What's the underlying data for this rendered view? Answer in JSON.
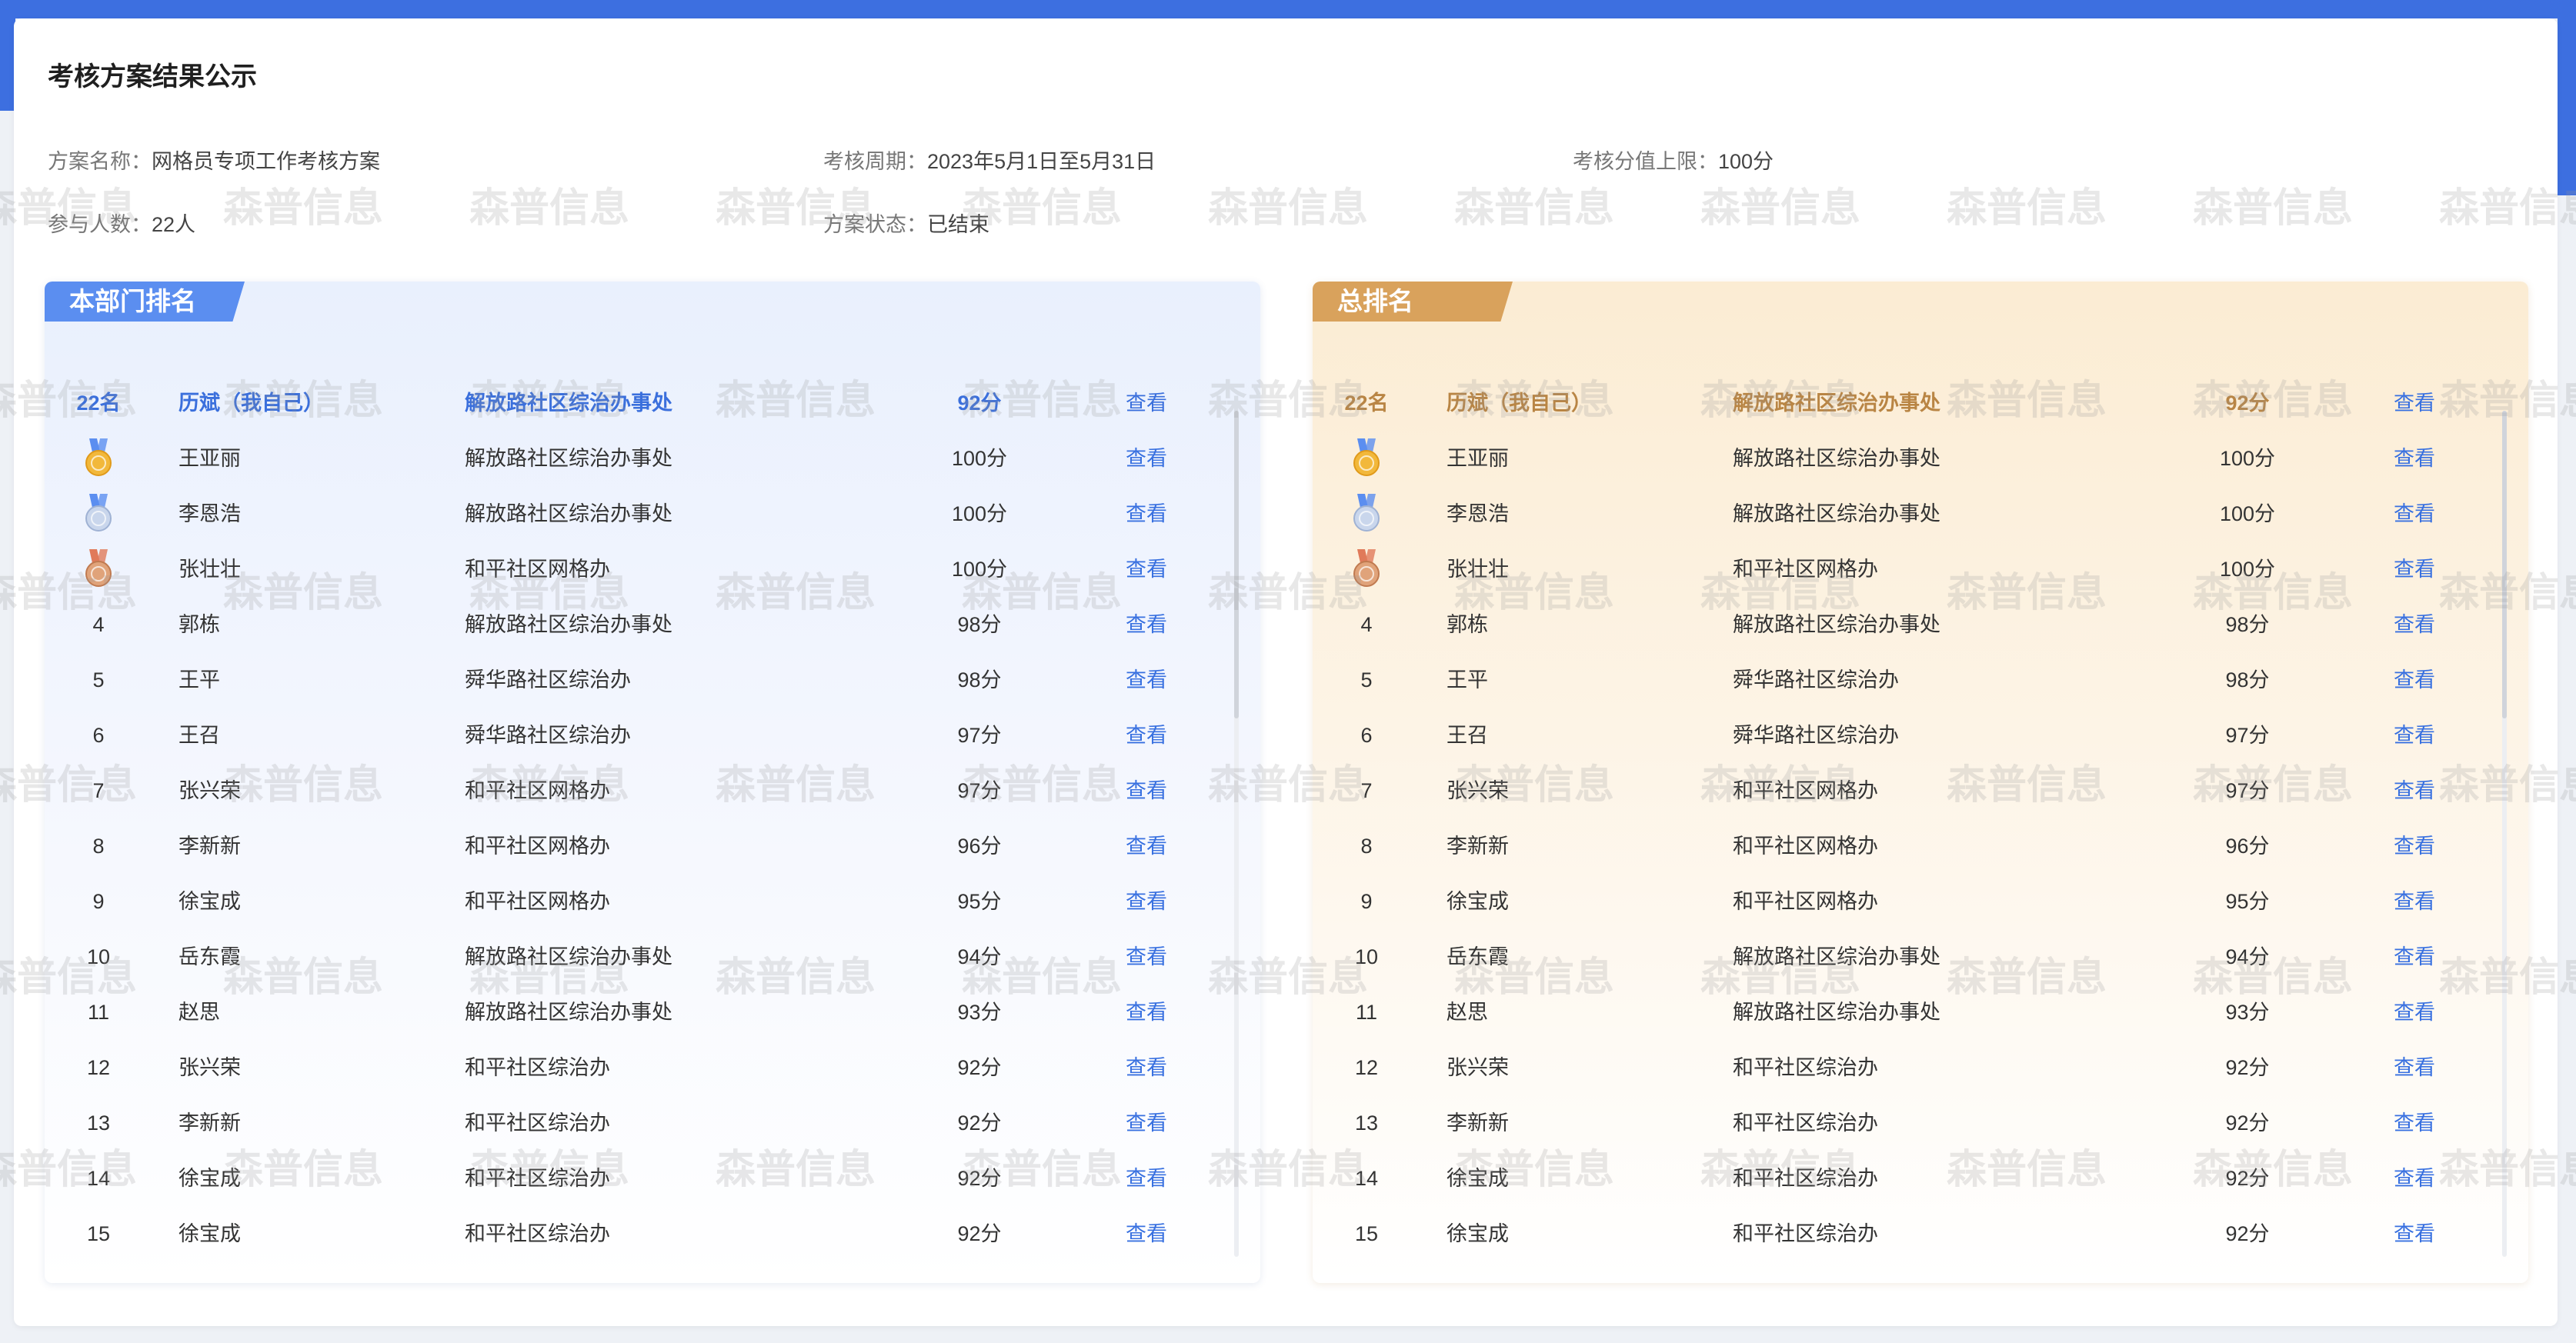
{
  "page": {
    "title": "考核方案结果公示"
  },
  "info": {
    "plan_name_label": "方案名称：",
    "plan_name_value": "网格员专项工作考核方案",
    "cycle_label": "考核周期：",
    "cycle_value": "2023年5月1日至5月31日",
    "max_score_label": "考核分值上限：",
    "max_score_value": "100分",
    "participants_label": "参与人数：",
    "participants_value": "22人",
    "status_label": "方案状态：",
    "status_value": "已结束"
  },
  "watermark_text": "森普信息",
  "colors": {
    "primary": "#3d6fe0",
    "left_tag": "#5b8ef0",
    "right_tag": "#d9a25c",
    "link": "#3870e0"
  },
  "dept_ranking": {
    "title": "本部门排名",
    "self_row": {
      "rank": "22名",
      "name": "历斌（我自己）",
      "dept": "解放路社区综治办事处",
      "score": "92分",
      "action": "查看"
    },
    "rows": [
      {
        "rank": "1",
        "medal": "gold-medal-icon",
        "name": "王亚丽",
        "dept": "解放路社区综治办事处",
        "score": "100分",
        "action": "查看"
      },
      {
        "rank": "2",
        "medal": "silver-medal-icon",
        "name": "李恩浩",
        "dept": "解放路社区综治办事处",
        "score": "100分",
        "action": "查看"
      },
      {
        "rank": "3",
        "medal": "bronze-medal-icon",
        "name": "张壮壮",
        "dept": "和平社区网格办",
        "score": "100分",
        "action": "查看"
      },
      {
        "rank": "4",
        "name": "郭栋",
        "dept": "解放路社区综治办事处",
        "score": "98分",
        "action": "查看"
      },
      {
        "rank": "5",
        "name": "王平",
        "dept": "舜华路社区综治办",
        "score": "98分",
        "action": "查看"
      },
      {
        "rank": "6",
        "name": "王召",
        "dept": "舜华路社区综治办",
        "score": "97分",
        "action": "查看"
      },
      {
        "rank": "7",
        "name": "张兴荣",
        "dept": "和平社区网格办",
        "score": "97分",
        "action": "查看"
      },
      {
        "rank": "8",
        "name": "李新新",
        "dept": "和平社区网格办",
        "score": "96分",
        "action": "查看"
      },
      {
        "rank": "9",
        "name": "徐宝成",
        "dept": "和平社区网格办",
        "score": "95分",
        "action": "查看"
      },
      {
        "rank": "10",
        "name": "岳东霞",
        "dept": "解放路社区综治办事处",
        "score": "94分",
        "action": "查看"
      },
      {
        "rank": "11",
        "name": "赵思",
        "dept": "解放路社区综治办事处",
        "score": "93分",
        "action": "查看"
      },
      {
        "rank": "12",
        "name": "张兴荣",
        "dept": "和平社区综治办",
        "score": "92分",
        "action": "查看"
      },
      {
        "rank": "13",
        "name": "李新新",
        "dept": "和平社区综治办",
        "score": "92分",
        "action": "查看"
      },
      {
        "rank": "14",
        "name": "徐宝成",
        "dept": "和平社区综治办",
        "score": "92分",
        "action": "查看"
      },
      {
        "rank": "15",
        "name": "徐宝成",
        "dept": "和平社区综治办",
        "score": "92分",
        "action": "查看"
      }
    ]
  },
  "total_ranking": {
    "title": "总排名",
    "self_row": {
      "rank": "22名",
      "name": "历斌（我自己）",
      "dept": "解放路社区综治办事处",
      "score": "92分",
      "action": "查看"
    },
    "rows": [
      {
        "rank": "1",
        "medal": "gold-medal-icon",
        "name": "王亚丽",
        "dept": "解放路社区综治办事处",
        "score": "100分",
        "action": "查看"
      },
      {
        "rank": "2",
        "medal": "silver-medal-icon",
        "name": "李恩浩",
        "dept": "解放路社区综治办事处",
        "score": "100分",
        "action": "查看"
      },
      {
        "rank": "3",
        "medal": "bronze-medal-icon",
        "name": "张壮壮",
        "dept": "和平社区网格办",
        "score": "100分",
        "action": "查看"
      },
      {
        "rank": "4",
        "name": "郭栋",
        "dept": "解放路社区综治办事处",
        "score": "98分",
        "action": "查看"
      },
      {
        "rank": "5",
        "name": "王平",
        "dept": "舜华路社区综治办",
        "score": "98分",
        "action": "查看"
      },
      {
        "rank": "6",
        "name": "王召",
        "dept": "舜华路社区综治办",
        "score": "97分",
        "action": "查看"
      },
      {
        "rank": "7",
        "name": "张兴荣",
        "dept": "和平社区网格办",
        "score": "97分",
        "action": "查看"
      },
      {
        "rank": "8",
        "name": "李新新",
        "dept": "和平社区网格办",
        "score": "96分",
        "action": "查看"
      },
      {
        "rank": "9",
        "name": "徐宝成",
        "dept": "和平社区网格办",
        "score": "95分",
        "action": "查看"
      },
      {
        "rank": "10",
        "name": "岳东霞",
        "dept": "解放路社区综治办事处",
        "score": "94分",
        "action": "查看"
      },
      {
        "rank": "11",
        "name": "赵思",
        "dept": "解放路社区综治办事处",
        "score": "93分",
        "action": "查看"
      },
      {
        "rank": "12",
        "name": "张兴荣",
        "dept": "和平社区综治办",
        "score": "92分",
        "action": "查看"
      },
      {
        "rank": "13",
        "name": "李新新",
        "dept": "和平社区综治办",
        "score": "92分",
        "action": "查看"
      },
      {
        "rank": "14",
        "name": "徐宝成",
        "dept": "和平社区综治办",
        "score": "92分",
        "action": "查看"
      },
      {
        "rank": "15",
        "name": "徐宝成",
        "dept": "和平社区综治办",
        "score": "92分",
        "action": "查看"
      }
    ]
  }
}
